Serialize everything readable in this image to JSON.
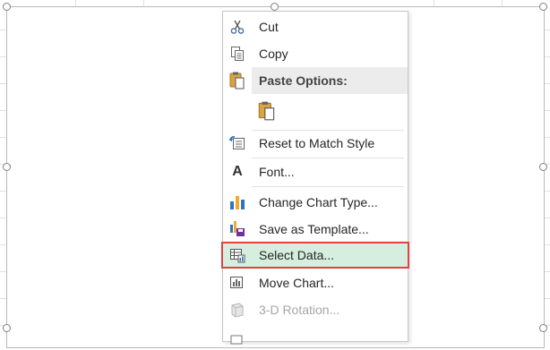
{
  "context_menu": {
    "cut": {
      "label": "Cut",
      "icon": "scissors-icon"
    },
    "copy": {
      "label": "Copy",
      "icon": "copy-icon"
    },
    "paste_options": {
      "label": "Paste Options:",
      "icon": "clipboard-icon"
    },
    "paste_button": {
      "icon": "paste-icon"
    },
    "reset_style": {
      "label": "Reset to Match Style",
      "icon": "reset-style-icon"
    },
    "font": {
      "label": "Font...",
      "icon": "font-icon"
    },
    "change_chart_type": {
      "label": "Change Chart Type...",
      "icon": "chart-type-icon"
    },
    "save_template": {
      "label": "Save as Template...",
      "icon": "save-template-icon"
    },
    "select_data": {
      "label": "Select Data...",
      "icon": "select-data-icon",
      "highlighted": true
    },
    "move_chart": {
      "label": "Move Chart...",
      "icon": "move-chart-icon"
    },
    "rotation_3d": {
      "label": "3-D Rotation...",
      "icon": "3d-rotation-icon",
      "disabled": true
    }
  },
  "colors": {
    "highlight_fill": "#d6eedf",
    "highlight_border": "#e0433e",
    "menu_header_fill": "#ececec",
    "chart_blue": "#2e75b6",
    "chart_orange": "#f0a830"
  }
}
